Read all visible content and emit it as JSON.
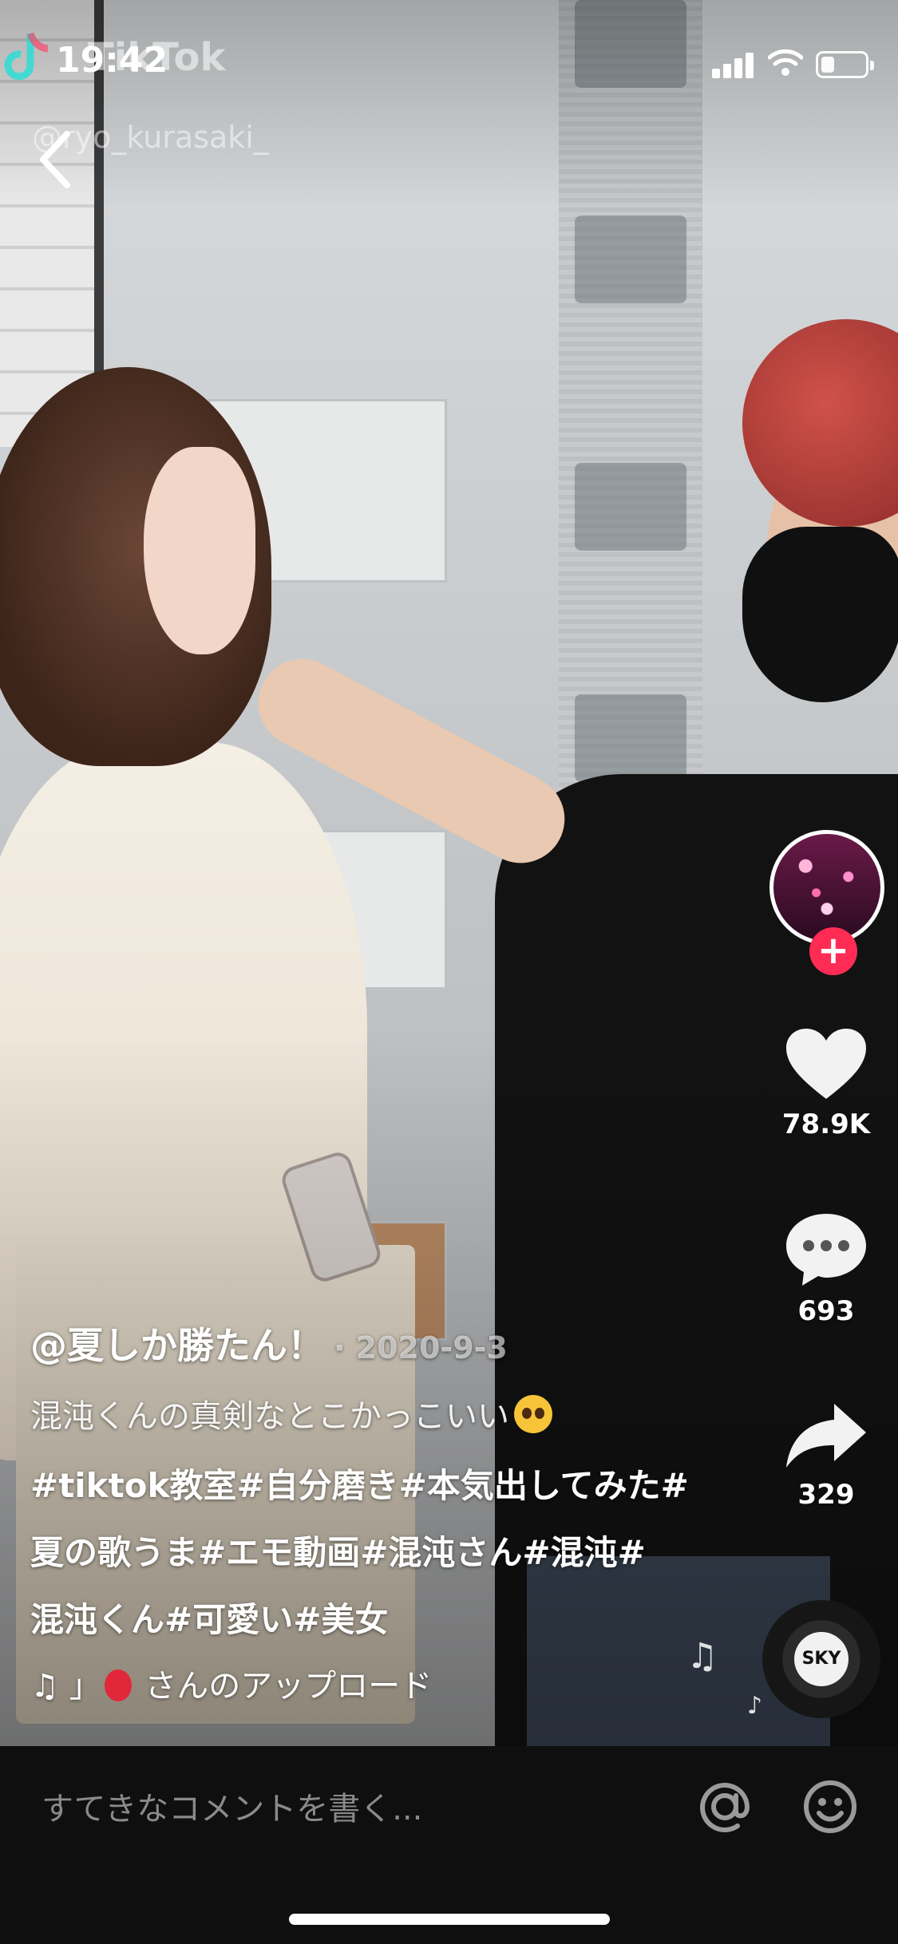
{
  "status_bar": {
    "time": "19:42",
    "battery_level": 0.3,
    "signal_bars": 4,
    "icons": [
      "signal-icon",
      "wifi-icon",
      "battery-icon"
    ]
  },
  "watermark": {
    "brand": "TikTok",
    "username": "@ryo_kurasaki_"
  },
  "video": {
    "author": "@夏しか勝たん！",
    "date": "· 2020-9-3",
    "description": "混沌くんの真剣なとこかっこいい",
    "hashtag_lines": [
      "#tiktok教室#自分磨き#本気出してみた#",
      "夏の歌うま#エモ動画#混沌さん#混沌#",
      "混沌くん#可愛い#美女"
    ],
    "music_prefix": "」",
    "music_suffix": "さんのアップロード"
  },
  "rail": {
    "likes": "78.9K",
    "comments": "693",
    "shares": "329",
    "follow_label": "+",
    "disc_label": "SKY"
  },
  "bottom": {
    "comment_placeholder": "すてきなコメントを書く..."
  },
  "colors": {
    "accent": "#fe2c55",
    "bar_bg": "#0f0f0f",
    "placeholder": "#8a8a8a"
  }
}
